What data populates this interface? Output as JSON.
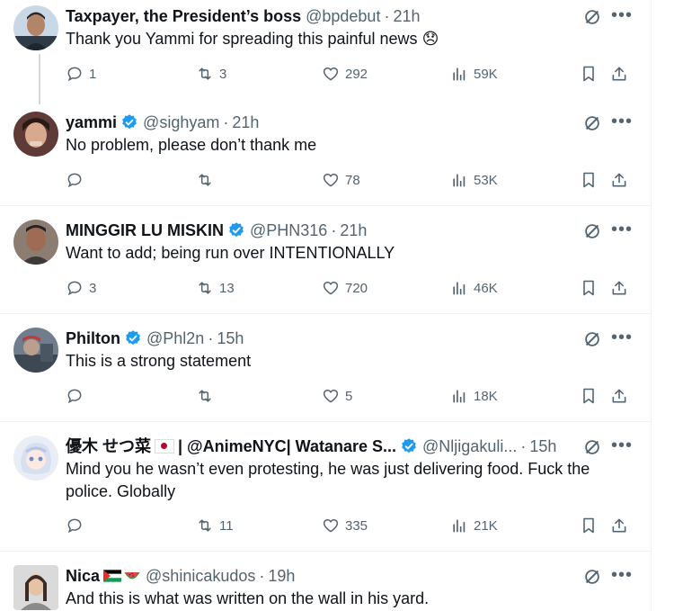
{
  "tweets": [
    {
      "name": "Taxpayer, the President’s boss",
      "handle": "@bpdebut",
      "time": "21h",
      "text": "Thank you Yammi for spreading this painful news",
      "emoji": "😞",
      "verified": false,
      "replies": "1",
      "retweets": "3",
      "likes": "292",
      "views": "59K"
    },
    {
      "name": "yammi",
      "handle": "@sighyam",
      "time": "21h",
      "text": "No problem, please don’t thank me",
      "verified": true,
      "replies": "",
      "retweets": "",
      "likes": "78",
      "views": "53K"
    },
    {
      "name": "MINGGIR LU MISKIN",
      "handle": "@PHN316",
      "time": "21h",
      "text": "Want to add; being run over INTENTIONALLY",
      "verified": true,
      "replies": "3",
      "retweets": "13",
      "likes": "720",
      "views": "46K"
    },
    {
      "name": "Philton",
      "handle": "@Phl2n",
      "time": "15h",
      "text": "This is a strong statement",
      "verified": true,
      "replies": "",
      "retweets": "",
      "likes": "5",
      "views": "18K"
    },
    {
      "name_part1": "優木 せつ菜",
      "name_part2": "| @AnimeNYC| Watanare S...",
      "handle": "@Nljigakuli...",
      "time": "15h",
      "text": "Mind you he wasn’t even protesting, he was just delivering food. Fuck the police. Globally",
      "verified": true,
      "replies": "",
      "retweets": "11",
      "likes": "335",
      "views": "21K"
    },
    {
      "name": "Nica",
      "handle": "@shinicakudos",
      "time": "19h",
      "text": "And this is what was written on the wall in his yard.",
      "verified": false
    }
  ],
  "more_label": "•••",
  "colors": {
    "verified": "#1d9bf0",
    "secondary": "#536471",
    "border": "#eff3f4"
  }
}
